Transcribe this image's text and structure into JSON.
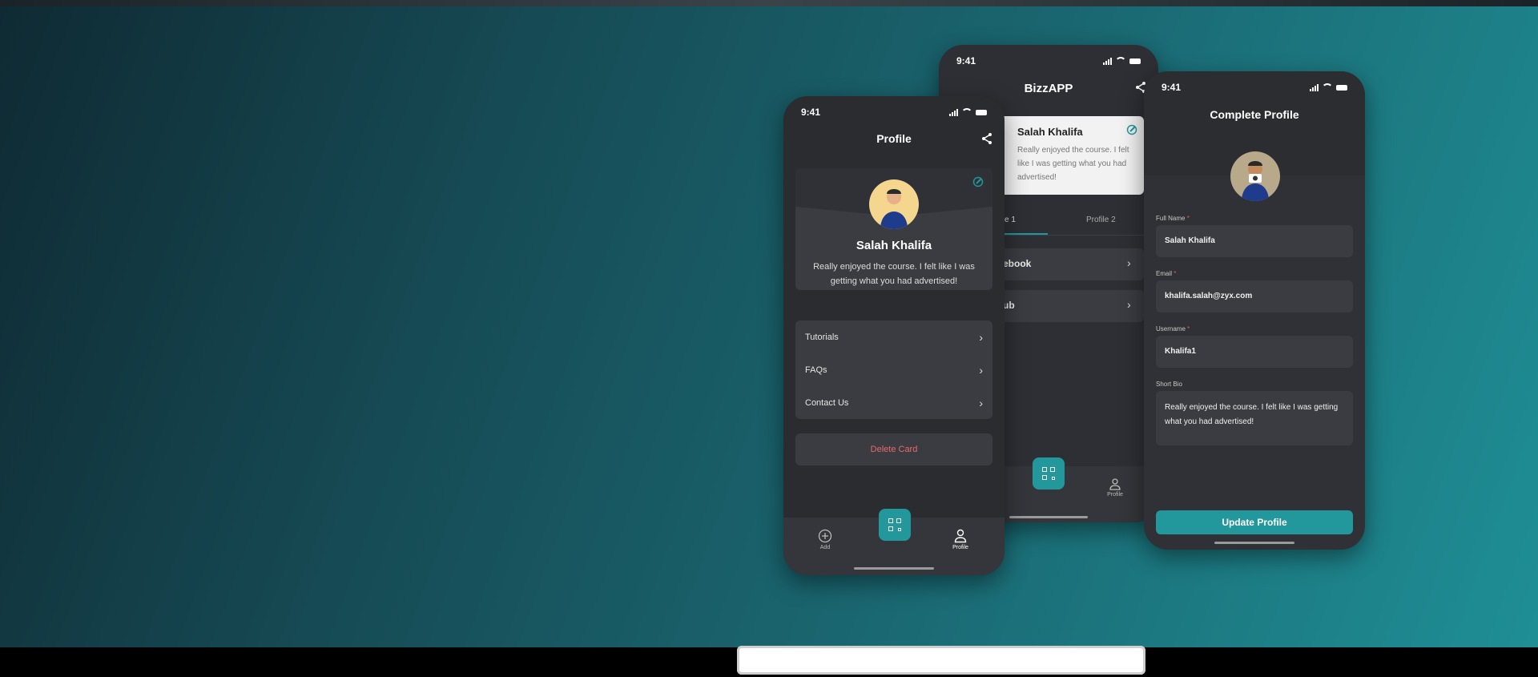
{
  "status_time": "9:41",
  "phone_profile": {
    "title": "Profile",
    "name": "Salah Khalifa",
    "bio": "Really enjoyed the course. I felt like I was getting what you had advertised!",
    "menu": [
      {
        "label": "Tutorials"
      },
      {
        "label": "FAQs"
      },
      {
        "label": "Contact Us"
      }
    ],
    "delete_label": "Delete Card",
    "tabs": {
      "add": "Add",
      "profile": "Profile"
    }
  },
  "phone_bizz": {
    "title": "BizzAPP",
    "name": "Salah Khalifa",
    "bio": "Really enjoyed the course. I felt like I was getting what you had advertised!",
    "tab1": "e 1",
    "tab2": "Profile 2",
    "rows": [
      {
        "label": "ebook"
      },
      {
        "label": "ub"
      }
    ],
    "tab_profile": "Profile"
  },
  "phone_complete": {
    "title": "Complete Profile",
    "fields": {
      "full_name_label": "Full Name",
      "full_name": "Salah Khalifa",
      "email_label": "Email",
      "email": "khalifa.salah@zyx.com",
      "username_label": "Username",
      "username": "Khalifa1",
      "bio_label": "Short Bio",
      "bio": "Really enjoyed the course. I felt like I was getting what you had advertised!"
    },
    "update_label": "Update Profile"
  },
  "colors": {
    "accent": "#22979c",
    "danger": "#e36b6b",
    "surface": "#2b2d31",
    "card": "#3a3c42"
  }
}
